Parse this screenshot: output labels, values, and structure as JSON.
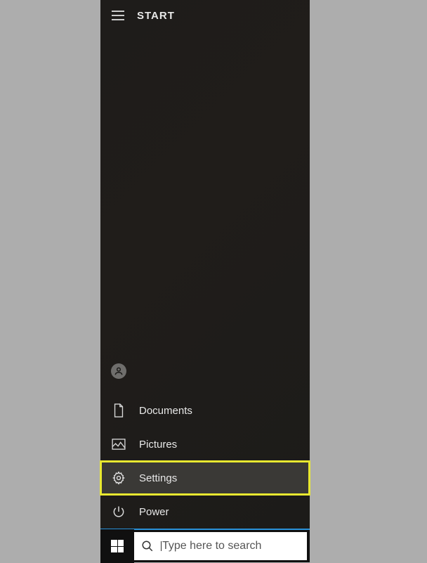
{
  "start": {
    "title": "START",
    "items": {
      "documents": "Documents",
      "pictures": "Pictures",
      "settings": "Settings",
      "power": "Power"
    }
  },
  "taskbar": {
    "search_placeholder": "Type here to search"
  }
}
